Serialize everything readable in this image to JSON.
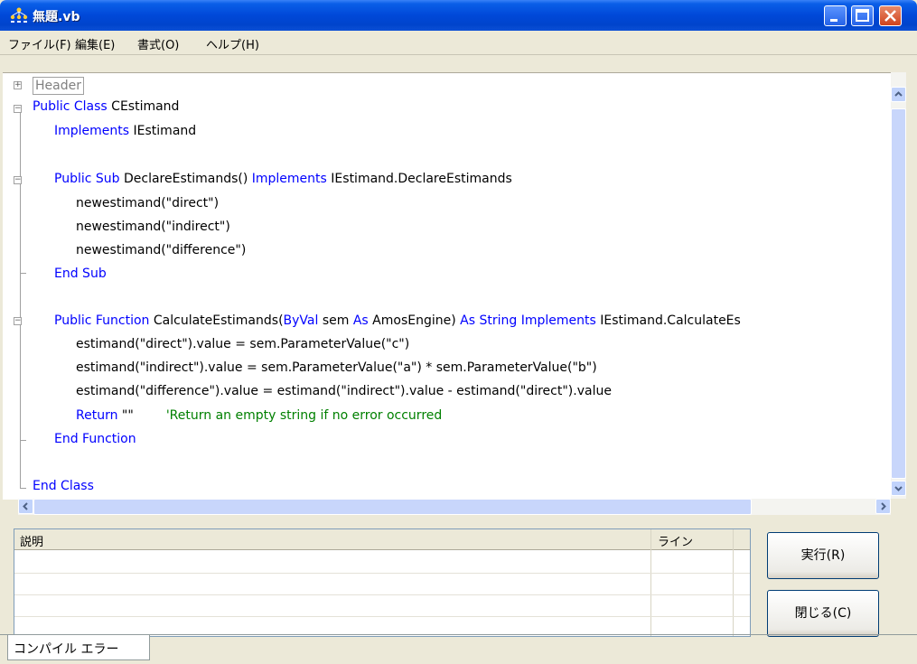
{
  "window": {
    "title": "無題.vb",
    "colors": {
      "titlebar": "#0048d8",
      "keyword": "#0000ff",
      "comment": "#008000"
    }
  },
  "menu": {
    "items": [
      "ファイル(F)",
      "編集(E)",
      "書式(O)",
      "ヘルプ(H)"
    ]
  },
  "editor": {
    "header_region": "Header",
    "lines": [
      {
        "kw1": "Public Class",
        "tx1": " CEstimand"
      },
      {
        "kw1": "Implements",
        "tx1": " IEstimand"
      },
      {
        "kw1": "Public Sub",
        "tx1": " DeclareEstimands() ",
        "kw2": "Implements",
        "tx2": " IEstimand.DeclareEstimands"
      },
      {
        "tx1": "newestimand(\"direct\")"
      },
      {
        "tx1": "newestimand(\"indirect\")"
      },
      {
        "tx1": "newestimand(\"difference\")"
      },
      {
        "kw1": "End Sub"
      },
      {
        "kw1": "Public Function",
        "tx1": " CalculateEstimands(",
        "kw2": "ByVal",
        "tx2": " sem ",
        "kw3": "As",
        "tx3": " AmosEngine) ",
        "kw4": "As String Implements",
        "tx4": " IEstimand.CalculateEs"
      },
      {
        "tx1": "estimand(\"direct\").value = sem.ParameterValue(\"c\")"
      },
      {
        "tx1": "estimand(\"indirect\").value = sem.ParameterValue(\"a\") * sem.ParameterValue(\"b\")"
      },
      {
        "tx1": "estimand(\"difference\").value = estimand(\"indirect\").value - estimand(\"direct\").value"
      },
      {
        "kw1": "Return",
        "tx1": " \"\"",
        "cm": "'Return an empty string if no error occurred"
      },
      {
        "kw1": "End Function"
      },
      {
        "kw1": "End Class"
      }
    ]
  },
  "errors": {
    "col_description": "説明",
    "col_line": "ライン"
  },
  "buttons": {
    "run": "実行(R)",
    "close": "閉じる(C)"
  },
  "tabs": {
    "compile_errors": "コンパイル エラー"
  }
}
